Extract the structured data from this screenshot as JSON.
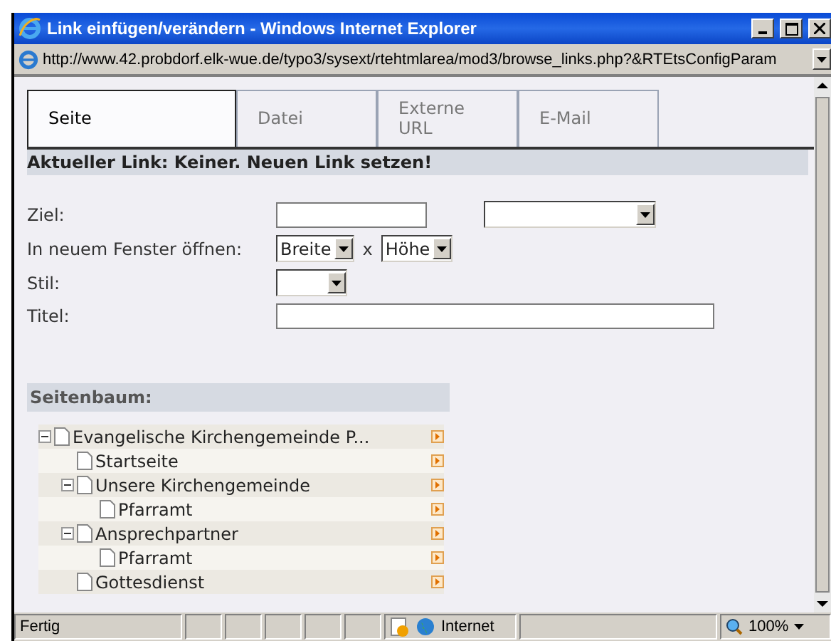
{
  "window": {
    "title": "Link einfügen/verändern - Windows Internet Explorer"
  },
  "address_bar": {
    "url": "http://www.42.probdorf.elk-wue.de/typo3/sysext/rtehtmlarea/mod3/browse_links.php?&RTEtsConfigParam"
  },
  "tabs": [
    {
      "label": "Seite",
      "selected": true
    },
    {
      "label": "Datei",
      "selected": false
    },
    {
      "label": "Externe URL",
      "selected": false
    },
    {
      "label": "E-Mail",
      "selected": false
    }
  ],
  "current_link": "Aktueller Link: Keiner. Neuen Link setzen!",
  "form": {
    "target_label": "Ziel:",
    "new_window_label": "In neuem Fenster öffnen:",
    "width_select": "Breite",
    "times": "x",
    "height_select": "Höhe",
    "style_label": "Stil:",
    "title_label": "Titel:"
  },
  "page_tree": {
    "heading": "Seitenbaum:",
    "items": [
      {
        "label": "Evangelische Kirchengemeinde P...",
        "expanded": true,
        "children": [
          {
            "label": "Startseite"
          },
          {
            "label": "Unsere Kirchengemeinde",
            "expanded": true,
            "children": [
              {
                "label": "Pfarramt"
              }
            ]
          },
          {
            "label": "Ansprechpartner",
            "expanded": true,
            "children": [
              {
                "label": "Pfarramt"
              }
            ]
          },
          {
            "label": "Gottesdienst"
          }
        ]
      }
    ]
  },
  "status_bar": {
    "status": "Fertig",
    "zone": "Internet",
    "zoom": "100%"
  }
}
